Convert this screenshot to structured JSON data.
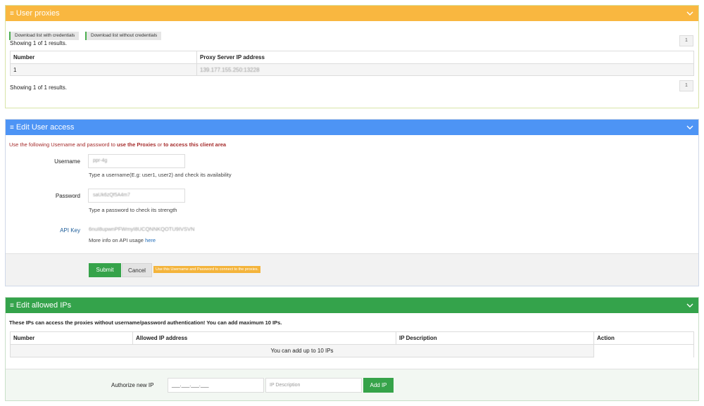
{
  "colors": {
    "orange": "#f9b740",
    "blue": "#4d94f5",
    "green": "#34a34b",
    "notice_red": "#a52b2b"
  },
  "user_proxies": {
    "title": "User proxies",
    "download_with_credentials": "Download list with credentials",
    "download_without_credentials": "Download list without credentials",
    "showing_top": "Showing 1 of 1 results.",
    "showing_bottom": "Showing 1 of 1 results.",
    "page": "1",
    "columns": [
      "Number",
      "Proxy Server IP address"
    ],
    "rows": [
      [
        "1",
        "139.177.155.250:13228"
      ]
    ]
  },
  "edit_user_access": {
    "title": "Edit User access",
    "notice_prefix": "Use the following Username and password to ",
    "notice_bold1": "use the Proxies",
    "notice_mid": " or ",
    "notice_bold2": "to access this client area",
    "username_label": "Username",
    "username_value": "ppr-4g",
    "username_help": "Type a username(E.g: user1, user2) and check its availability",
    "password_label": "Password",
    "password_value": "saUk6zQf5A4m7",
    "password_help": "Type a password to check its strength",
    "apikey_label": "API Key",
    "apikey_value": "6nuI8upwnPFWmyI8UCQNNKQOTU9IVSVN",
    "apikey_help": "More info on API usage ",
    "apikey_help_link": "here",
    "submit": "Submit",
    "cancel": "Cancel",
    "hint": "Use this Username and Password to connect to the proxies."
  },
  "edit_allowed_ips": {
    "title": "Edit allowed IPs",
    "notice": "These IPs can access the proxies without username/password authentication! You can add maximum 10 IPs.",
    "columns": [
      "Number",
      "Allowed IP address",
      "IP Description",
      "Action"
    ],
    "empty_row": "You can add up to 10 IPs",
    "authorize_label": "Authorize new IP",
    "ip_placeholder": "___.___.___.___",
    "desc_placeholder": "IP Description",
    "add_ip": "Add IP"
  }
}
